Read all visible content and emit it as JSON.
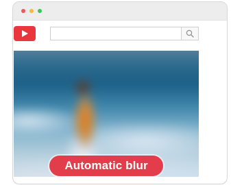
{
  "window": {
    "traffic_lights": {
      "close": "#f0555a",
      "minimize": "#f6b93b",
      "maximize": "#34c759"
    }
  },
  "header": {
    "logo_icon": "play-button-icon",
    "logo_color": "#e8363c",
    "search": {
      "value": "",
      "placeholder": "",
      "icon": "search-icon"
    }
  },
  "video": {
    "badge_label": "Automatic blur",
    "badge_color": "#e33c4b"
  }
}
